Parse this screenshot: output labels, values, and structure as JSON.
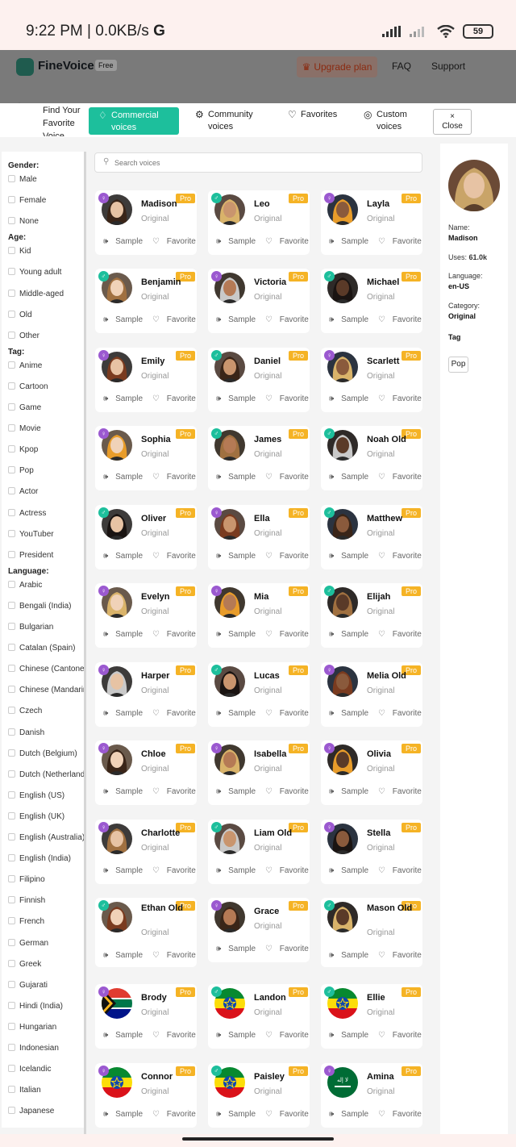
{
  "status_bar": {
    "time": "9:22 PM | 0.0KB/s",
    "g_icon": "G",
    "battery": "59"
  },
  "header": {
    "brand": "FineVoice",
    "badge": "Free",
    "upgrade": "Upgrade plan",
    "faq": "FAQ",
    "support": "Support"
  },
  "tabs": {
    "find": "Find Your Favorite Voice",
    "commercial": "Commercial voices",
    "community": "Community voices",
    "favorites": "Favorites",
    "custom": "Custom voices",
    "close_icon": "×",
    "close": "Close"
  },
  "filters": {
    "gender_head": "Gender:",
    "gender": [
      "Male",
      "Female",
      "None"
    ],
    "age_head": "Age:",
    "age": [
      "Kid",
      "Young adult",
      "Middle-aged",
      "Old",
      "Other"
    ],
    "tag_head": "Tag:",
    "tag": [
      "Anime",
      "Cartoon",
      "Game",
      "Movie",
      "Kpop",
      "Pop",
      "Actor",
      "Actress",
      "YouTuber",
      "President"
    ],
    "language_head": "Language:",
    "language": [
      "Arabic",
      "Bengali (India)",
      "Bulgarian",
      "Catalan (Spain)",
      "Chinese (Cantonese)",
      "Chinese (Mandarin)",
      "Czech",
      "Danish",
      "Dutch (Belgium)",
      "Dutch (Netherlands)",
      "English (US)",
      "English (UK)",
      "English (Australia)",
      "English (India)",
      "Filipino",
      "Finnish",
      "French",
      "German",
      "Greek",
      "Gujarati",
      "Hindi (India)",
      "Hungarian",
      "Indonesian",
      "Icelandic",
      "Italian",
      "Japanese"
    ]
  },
  "search": {
    "placeholder": "Search voices"
  },
  "card_labels": {
    "pro": "Pro",
    "type": "Original",
    "sample": "Sample",
    "favorite": "Favorite"
  },
  "voices": [
    {
      "name": "Madison",
      "gender": "female"
    },
    {
      "name": "Leo",
      "gender": "male"
    },
    {
      "name": "Layla",
      "gender": "female"
    },
    {
      "name": "Benjamin",
      "gender": "male"
    },
    {
      "name": "Victoria",
      "gender": "female"
    },
    {
      "name": "Michael",
      "gender": "male"
    },
    {
      "name": "Emily",
      "gender": "female"
    },
    {
      "name": "Daniel",
      "gender": "male"
    },
    {
      "name": "Scarlett",
      "gender": "female"
    },
    {
      "name": "Sophia",
      "gender": "female"
    },
    {
      "name": "James",
      "gender": "male"
    },
    {
      "name": "Noah Old",
      "gender": "male"
    },
    {
      "name": "Oliver",
      "gender": "male"
    },
    {
      "name": "Ella",
      "gender": "female"
    },
    {
      "name": "Matthew",
      "gender": "male"
    },
    {
      "name": "Evelyn",
      "gender": "female"
    },
    {
      "name": "Mia",
      "gender": "female"
    },
    {
      "name": "Elijah",
      "gender": "male"
    },
    {
      "name": "Harper",
      "gender": "female"
    },
    {
      "name": "Lucas",
      "gender": "male"
    },
    {
      "name": "Melia Old",
      "gender": "female"
    },
    {
      "name": "Chloe",
      "gender": "female"
    },
    {
      "name": "Isabella",
      "gender": "female"
    },
    {
      "name": "Olivia",
      "gender": "female"
    },
    {
      "name": "Charlotte",
      "gender": "female"
    },
    {
      "name": "Liam Old",
      "gender": "male"
    },
    {
      "name": "Stella",
      "gender": "female"
    },
    {
      "name": "Ethan Old",
      "gender": "male"
    },
    {
      "name": "Grace",
      "gender": "female"
    },
    {
      "name": "Mason Old",
      "gender": "male"
    },
    {
      "name": "Brody",
      "gender": "female"
    },
    {
      "name": "Landon",
      "gender": "male"
    },
    {
      "name": "Ellie",
      "gender": "male"
    },
    {
      "name": "Connor",
      "gender": "female"
    },
    {
      "name": "Paisley",
      "gender": "male"
    },
    {
      "name": "Amina",
      "gender": "female"
    }
  ],
  "detail": {
    "name_label": "Name:",
    "name": "Madison",
    "uses_label": "Uses:",
    "uses": "61.0k",
    "language_label": "Language:",
    "language": "en-US",
    "category_label": "Category:",
    "category": "Original",
    "tag_label": "Tag",
    "tag": "Pop"
  }
}
